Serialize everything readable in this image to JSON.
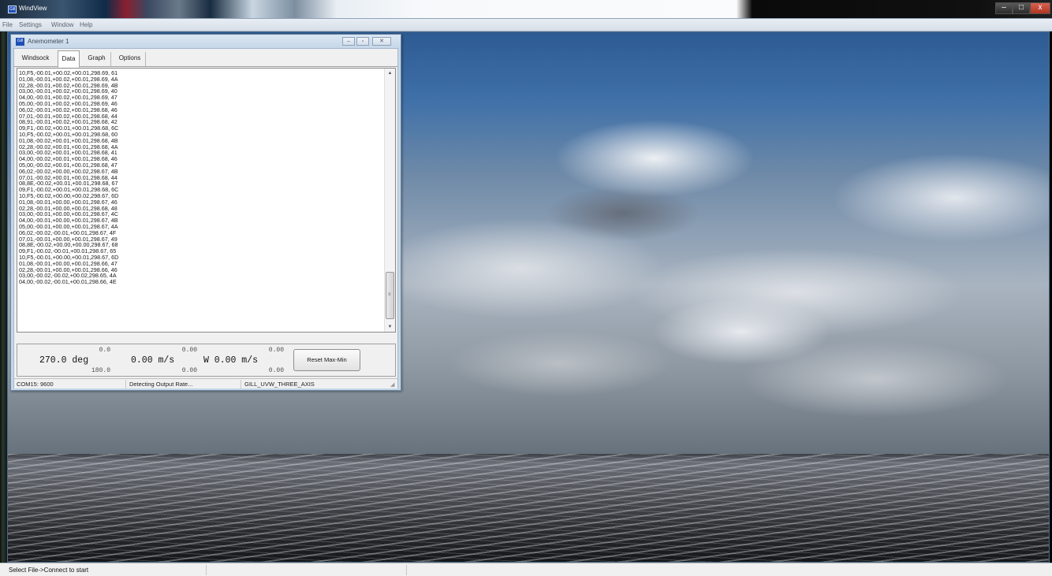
{
  "app": {
    "icon_text": "Gill",
    "title": "WindView",
    "caption_buttons": {
      "minimize": "–",
      "maximize": "□",
      "close": "x"
    }
  },
  "menu": [
    "File",
    "Settings",
    "Window",
    "Help"
  ],
  "child_window": {
    "icon_text": "Gill",
    "title": "Anemometer 1",
    "caption_buttons": {
      "minimize": "–",
      "restore": "▫",
      "close": "✕"
    }
  },
  "tabs": [
    "Windsock",
    "Data",
    "Graph",
    "Options"
  ],
  "active_tab": "Data",
  "data_lines": [
    "10,F5,-00.01,+00.02,+00.01,298.69, 61",
    "01,08,-00.01,+00.02,+00.01,298.69, 4A",
    "02,28,-00.01,+00.02,+00.01,298.69, 4B",
    "03,00,-00.01,+00.02,+00.01,298.69, 40",
    "04,00,-00.01,+00.02,+00.01,298.69, 47",
    "05,00,-00.01,+00.02,+00.01,298.69, 46",
    "06,02,-00.01,+00.02,+00.01,298.68, 46",
    "07,01,-00.01,+00.02,+00.01,298.68, 44",
    "08,91,-00.01,+00.02,+00.01,298.68, 42",
    "09,F1,-00.02,+00.01,+00.01,298.68, 6C",
    "10,F5,-00.02,+00.01,+00.01,298.68, 60",
    "01,08,-00.02,+00.01,+00.01,298.68, 4B",
    "02,28,-00.02,+00.01,+00.01,298.68, 4A",
    "03,00,-00.02,+00.01,+00.01,298.68, 41",
    "04,00,-00.02,+00.01,+00.01,298.68, 46",
    "05,00,-00.02,+00.01,+00.01,298.68, 47",
    "06,02,-00.02,+00.00,+00.02,298.67, 4B",
    "07,01,-00.02,+00.01,+00.01,298.68, 44",
    "08,8E,-00.02,+00.01,+00.01,298.68, 67",
    "09,F1,-00.02,+00.01,+00.01,298.68, 6C",
    "10,F5,-00.02,+00.00,+00.02,298.67, 6D",
    "01,08,-00.01,+00.00,+00.01,298.67, 46",
    "02,28,-00.01,+00.00,+00.01,298.68, 48",
    "03,00,-00.01,+00.00,+00.01,298.67, 4C",
    "04,00,-00.01,+00.00,+00.01,298.67, 4B",
    "05,00,-00.01,+00.00,+00.01,298.67, 4A",
    "06,02,-00.02,-00.01,+00.01,298.67, 4F",
    "07,01,-00.01,+00.00,+00.01,298.67, 49",
    "08,8E,-00.02,+00.00,+00.00,298.67, 68",
    "09,F1,-00.02,-00.01,+00.01,298.67, 65",
    "10,F5,-00.01,+00.00,+00.01,298.67, 6D",
    "01,08,-00.01,+00.00,+00.01,298.66, 47",
    "02,28,-00.01,+00.00,+00.01,298.66, 46",
    "03,00,-00.02,-00.02,+00.02,298.65, 4A",
    "04,00,-00.02,-00.01,+00.01,298.66, 4E"
  ],
  "scrollbar": {
    "up_glyph": "▲",
    "down_glyph": "▼",
    "grip_glyph": "≡"
  },
  "readouts": {
    "direction": {
      "max": "0.0",
      "value": "270.0 deg",
      "min": "180.0"
    },
    "speed": {
      "max": "0.00",
      "value": "0.00 m/s",
      "min": "0.00"
    },
    "vertical": {
      "max": "0.00",
      "value": "W 0.00 m/s",
      "min": "0.00"
    },
    "reset_label": "Reset Max-Min"
  },
  "child_status": {
    "port": "COM15: 9600",
    "rate": "Detecting Output Rate...",
    "mode": "GILL_UVW_THREE_AXIS",
    "grip_glyph": "◢"
  },
  "main_status": {
    "message": "Select File->Connect to start",
    "cell2": "",
    "cell3": ""
  },
  "colors": {
    "accent": "#1f4fb4",
    "child_frame": "#c5d6e8",
    "close_button": "#c5432f"
  },
  "icons": [
    "app-icon",
    "child-icon",
    "minimize-icon",
    "maximize-icon",
    "close-icon",
    "scroll-up-icon",
    "scroll-down-icon",
    "resize-grip-icon"
  ]
}
